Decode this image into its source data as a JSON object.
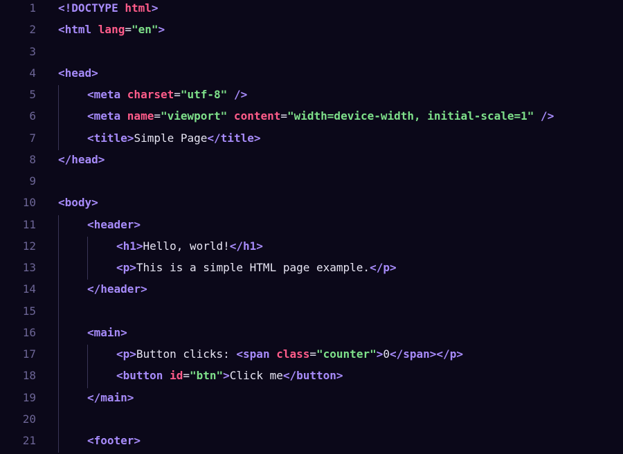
{
  "editor": {
    "lines": [
      {
        "n": "1",
        "indent": 0,
        "tokens": [
          [
            "b",
            "<!DOCTYPE "
          ],
          [
            "an",
            "html"
          ],
          [
            "b",
            ">"
          ]
        ]
      },
      {
        "n": "2",
        "indent": 0,
        "tokens": [
          [
            "b",
            "<html "
          ],
          [
            "an",
            "lang"
          ],
          [
            "eq",
            "="
          ],
          [
            "str",
            "\"en\""
          ],
          [
            "b",
            ">"
          ]
        ]
      },
      {
        "n": "3",
        "indent": 0,
        "tokens": []
      },
      {
        "n": "4",
        "indent": 0,
        "tokens": [
          [
            "b",
            "<head>"
          ]
        ]
      },
      {
        "n": "5",
        "indent": 1,
        "tokens": [
          [
            "b",
            "<meta "
          ],
          [
            "an",
            "charset"
          ],
          [
            "eq",
            "="
          ],
          [
            "str",
            "\"utf-8\""
          ],
          [
            "b",
            " />"
          ]
        ]
      },
      {
        "n": "6",
        "indent": 1,
        "tokens": [
          [
            "b",
            "<meta "
          ],
          [
            "an",
            "name"
          ],
          [
            "eq",
            "="
          ],
          [
            "str",
            "\"viewport\""
          ],
          [
            "an",
            " content"
          ],
          [
            "eq",
            "="
          ],
          [
            "str",
            "\"width=device-width, initial-scale=1\""
          ],
          [
            "b",
            " />"
          ]
        ]
      },
      {
        "n": "7",
        "indent": 1,
        "tokens": [
          [
            "b",
            "<title>"
          ],
          [
            "txt",
            "Simple Page"
          ],
          [
            "b",
            "</title>"
          ]
        ]
      },
      {
        "n": "8",
        "indent": 0,
        "tokens": [
          [
            "b",
            "</head>"
          ]
        ]
      },
      {
        "n": "9",
        "indent": 0,
        "tokens": []
      },
      {
        "n": "10",
        "indent": 0,
        "tokens": [
          [
            "b",
            "<body>"
          ]
        ]
      },
      {
        "n": "11",
        "indent": 1,
        "tokens": [
          [
            "b",
            "<header>"
          ]
        ]
      },
      {
        "n": "12",
        "indent": 2,
        "tokens": [
          [
            "b",
            "<h1>"
          ],
          [
            "txt",
            "Hello, world!"
          ],
          [
            "b",
            "</h1>"
          ]
        ]
      },
      {
        "n": "13",
        "indent": 2,
        "tokens": [
          [
            "b",
            "<p>"
          ],
          [
            "txt",
            "This is a simple HTML page example."
          ],
          [
            "b",
            "</p>"
          ]
        ]
      },
      {
        "n": "14",
        "indent": 1,
        "tokens": [
          [
            "b",
            "</header>"
          ]
        ]
      },
      {
        "n": "15",
        "indent": 0,
        "tokens": []
      },
      {
        "n": "16",
        "indent": 1,
        "tokens": [
          [
            "b",
            "<main>"
          ]
        ]
      },
      {
        "n": "17",
        "indent": 2,
        "tokens": [
          [
            "b",
            "<p>"
          ],
          [
            "txt",
            "Button clicks: "
          ],
          [
            "b",
            "<span "
          ],
          [
            "an",
            "class"
          ],
          [
            "eq",
            "="
          ],
          [
            "str",
            "\"counter\""
          ],
          [
            "b",
            ">"
          ],
          [
            "txt",
            "0"
          ],
          [
            "b",
            "</span></p>"
          ]
        ]
      },
      {
        "n": "18",
        "indent": 2,
        "tokens": [
          [
            "b",
            "<button "
          ],
          [
            "an",
            "id"
          ],
          [
            "eq",
            "="
          ],
          [
            "str",
            "\"btn\""
          ],
          [
            "b",
            ">"
          ],
          [
            "txt",
            "Click me"
          ],
          [
            "b",
            "</button>"
          ]
        ]
      },
      {
        "n": "19",
        "indent": 1,
        "tokens": [
          [
            "b",
            "</main>"
          ]
        ]
      },
      {
        "n": "20",
        "indent": 0,
        "tokens": []
      },
      {
        "n": "21",
        "indent": 1,
        "tokens": [
          [
            "b",
            "<footer>"
          ]
        ]
      }
    ]
  }
}
